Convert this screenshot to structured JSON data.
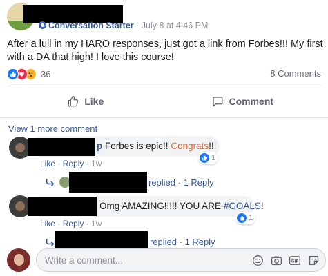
{
  "post": {
    "page_label": "Conversation Starter",
    "dot": "·",
    "timestamp": "July 8 at 4:46 PM",
    "text": "After a lull in my HARO responses, just got a link from Forbes!!! My first with a DA that high! I love this course!",
    "reaction_icons": [
      "like-icon",
      "love-icon",
      "wow-icon"
    ],
    "reaction_count": "36",
    "comments_count": "8 Comments",
    "actions": {
      "like": "Like",
      "comment": "Comment"
    }
  },
  "comments": {
    "view_more": "View 1 more comment",
    "items": [
      {
        "name_fragment": "p",
        "text_before": "Forbes is epic!!",
        "highlight": "Congrats",
        "text_after": "!!!",
        "like_count": "1",
        "action_like": "Like",
        "action_reply": "Reply",
        "time": "1w",
        "replies_text": "replied · 1 Reply"
      },
      {
        "text_before": "Omg AMAZING!!!!! YOU ARE",
        "tag": "#GOALS",
        "text_after": "!",
        "like_count": "1",
        "action_like": "Like",
        "action_reply": "Reply",
        "time": "1w",
        "replies_text": "replied · 1 Reply"
      }
    ],
    "separator": " · "
  },
  "composer": {
    "placeholder": "Write a comment...",
    "icons": [
      "emoji-icon",
      "camera-icon",
      "gif-icon",
      "sticker-icon"
    ]
  },
  "colors": {
    "link": "#385898",
    "meta": "#90949c",
    "like_blue": "#1877f2",
    "congrats": "#e9622d"
  }
}
